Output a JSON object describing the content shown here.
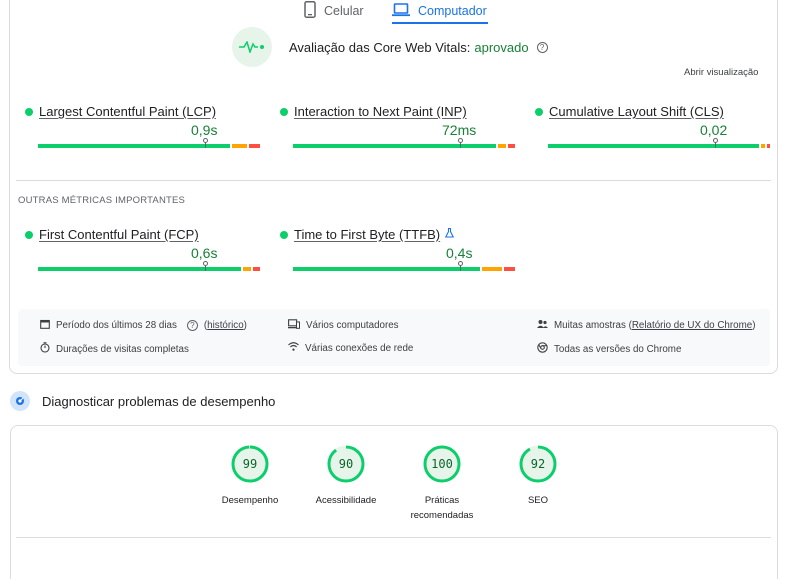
{
  "tabs": {
    "mobile_label": "Celular",
    "desktop_label": "Computador",
    "mobile_icon": "phone-icon",
    "desktop_icon": "laptop-icon"
  },
  "cwv": {
    "title": "Avaliação das Core Web Vitals:",
    "status": "aprovado",
    "help_icon": "?",
    "expand_label": "Abrir visualização"
  },
  "core_metrics": [
    {
      "name": "Largest Contentful Paint (LCP)",
      "value": "0,9s",
      "status": "good",
      "distribution": {
        "good": 0.88,
        "avg": 0.07,
        "poor": 0.05
      },
      "marker": 0.75
    },
    {
      "name": "Interaction to Next Paint (INP)",
      "value": "72ms",
      "status": "good",
      "distribution": {
        "good": 0.93,
        "avg": 0.04,
        "poor": 0.03
      },
      "marker": 0.75
    },
    {
      "name": "Cumulative Layout Shift (CLS)",
      "value": "0,02",
      "status": "good",
      "distribution": {
        "good": 0.97,
        "avg": 0.015,
        "poor": 0.015
      },
      "marker": 0.75
    }
  ],
  "other_section_label": "OUTRAS MÉTRICAS IMPORTANTES",
  "other_metrics": [
    {
      "name": "First Contentful Paint (FCP)",
      "value": "0,6s",
      "status": "good",
      "distribution": {
        "good": 0.93,
        "avg": 0.04,
        "poor": 0.03
      },
      "marker": 0.75
    },
    {
      "name": "Time to First Byte (TTFB)",
      "value": "0,4s",
      "status": "good",
      "distribution": {
        "good": 0.86,
        "avg": 0.09,
        "poor": 0.05
      },
      "marker": 0.75,
      "lab_icon": "flask-icon"
    }
  ],
  "info": {
    "period_text": "Período dos últimos 28 dias",
    "period_link": "histórico",
    "devices": "Vários computadores",
    "samples_text": "Muitas amostras",
    "samples_link": "Relatório de UX do Chrome",
    "durations": "Durações de visitas completas",
    "networks": "Várias conexões de rede",
    "chrome_versions": "Todas as versões do Chrome"
  },
  "diagnose": {
    "title": "Diagnosticar problemas de desempenho"
  },
  "scores": [
    {
      "value": "99",
      "label_line1": "Desempenho",
      "label_line2": "",
      "fraction": 0.99
    },
    {
      "value": "90",
      "label_line1": "Acessibilidade",
      "label_line2": "",
      "fraction": 0.9
    },
    {
      "value": "100",
      "label_line1": "Práticas",
      "label_line2": "recomendadas",
      "fraction": 1.0
    },
    {
      "value": "92",
      "label_line1": "SEO",
      "label_line2": "",
      "fraction": 0.92
    }
  ],
  "colors": {
    "accent": "#1a73e8",
    "good": "#0cce6b",
    "good_text": "#188038",
    "average": "#ffa400",
    "poor": "#ff4e42"
  }
}
